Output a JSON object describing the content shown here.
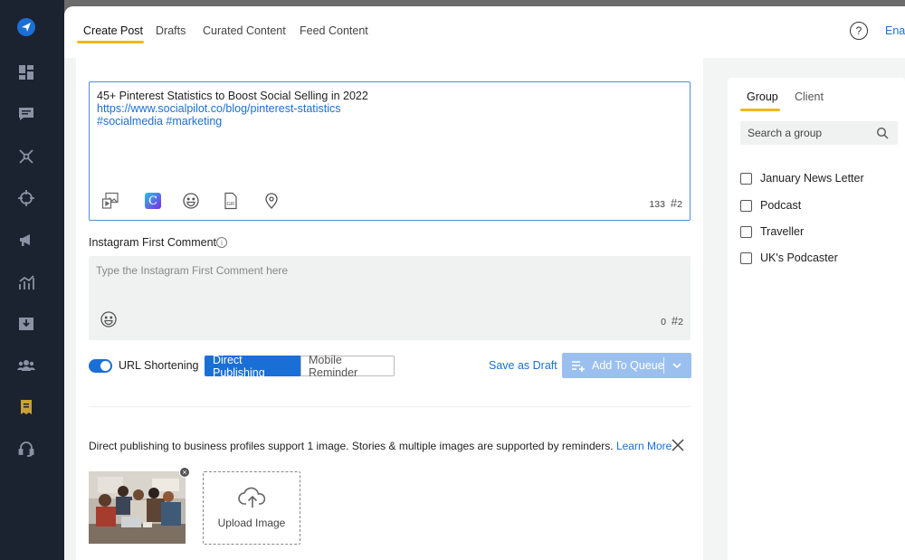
{
  "tabs": {
    "create_post": "Create Post",
    "drafts": "Drafts",
    "curated": "Curated Content",
    "feed": "Feed Content"
  },
  "header": {
    "help_icon": "?",
    "enable_link": "Enal"
  },
  "post": {
    "line1": "45+ Pinterest Statistics to Boost Social Selling in 2022",
    "line2": "https://www.socialpilot.co/blog/pinterest-statistics",
    "line3": "#socialmedia #marketing",
    "char_count": "133",
    "hashtag_count": "2",
    "canva_letter": "C"
  },
  "instagram": {
    "label": "Instagram First Comment",
    "info_icon": "i",
    "placeholder": "Type the Instagram First Comment here",
    "char_count": "0",
    "hashtag_count": "2"
  },
  "controls": {
    "url_shortening": "URL Shortening",
    "direct_publishing": "Direct Publishing",
    "mobile_reminder": "Mobile Reminder",
    "save_draft": "Save as Draft",
    "add_to_queue": "Add To Queue"
  },
  "notice": {
    "text": "Direct publishing to business profiles support 1 image. Stories & multiple images are supported by reminders. ",
    "link": "Learn More"
  },
  "media": {
    "upload_label": "Upload Image",
    "remove_glyph": "×"
  },
  "groups": {
    "tab_group": "Group",
    "tab_client": "Client",
    "search_placeholder": "Search a group",
    "items": [
      "January News Letter",
      "Podcast",
      "Traveller",
      "UK's Podcaster"
    ]
  },
  "colors": {
    "accent": "#1a6fd6",
    "sidebar": "#1b2230",
    "tab_underline": "#f2b81d",
    "queue_button": "#9bc0ef"
  }
}
